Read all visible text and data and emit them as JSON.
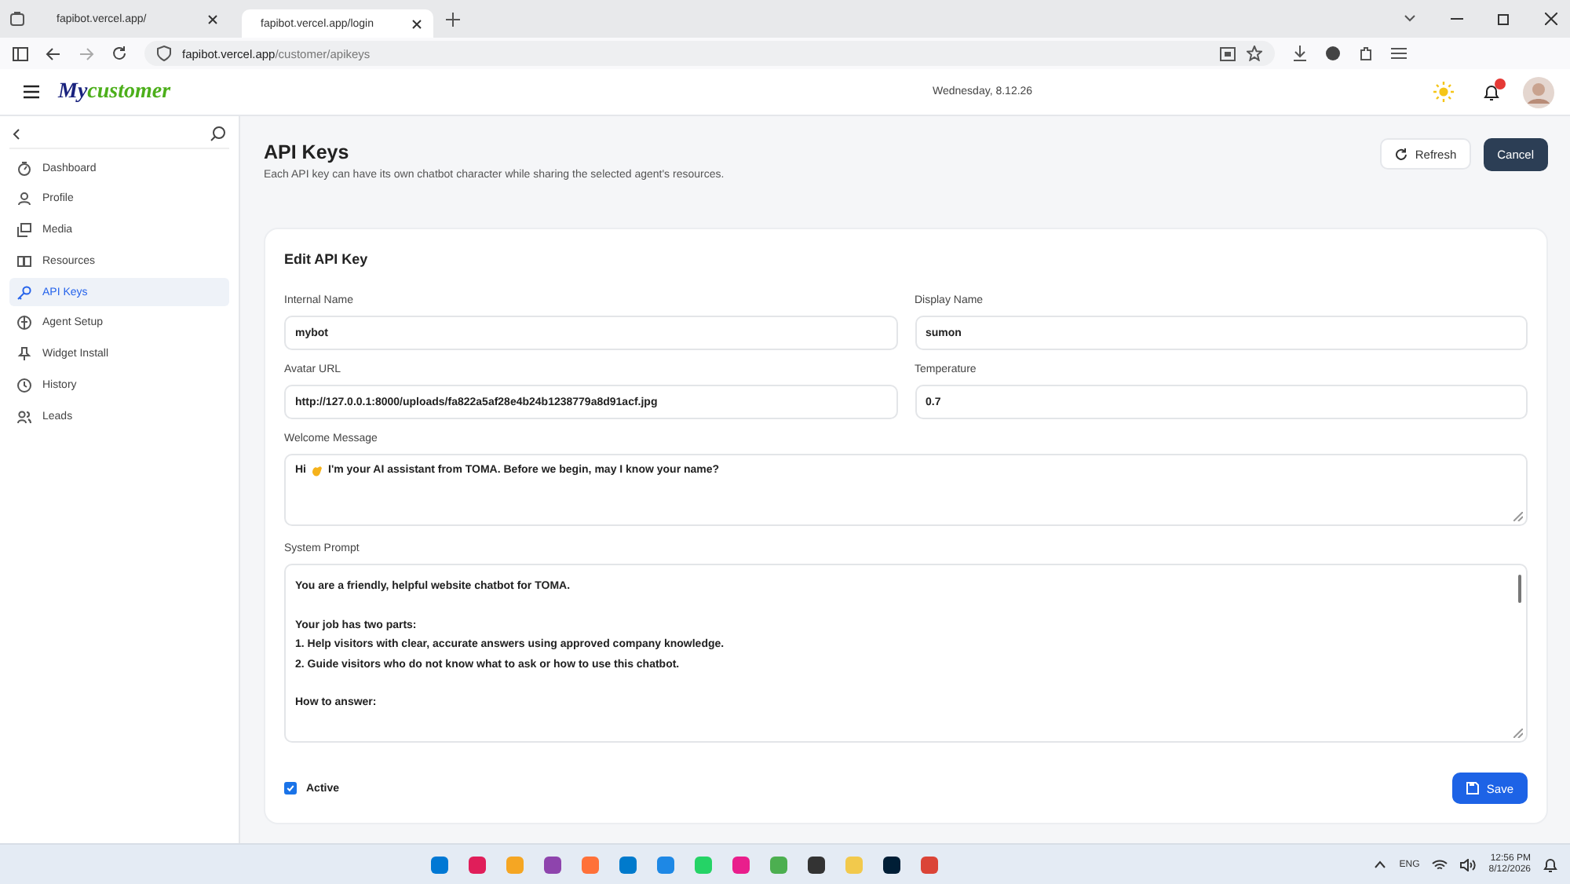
{
  "browser": {
    "tabs": [
      {
        "label": "fapibot.vercel.app/",
        "selected": false
      },
      {
        "label": "fapibot.vercel.app/login",
        "selected": true
      }
    ],
    "address": {
      "host": "fapibot.vercel.app",
      "path": "/customer/apikeys"
    }
  },
  "header": {
    "logo_first": "My",
    "logo_second": "customer",
    "date": "Wednesday, 8.12.26"
  },
  "sidebar": {
    "items": [
      {
        "label": "Dashboard",
        "selected": false
      },
      {
        "label": "Profile",
        "selected": false
      },
      {
        "label": "Media",
        "selected": false
      },
      {
        "label": "Resources",
        "selected": false
      },
      {
        "label": "API Keys",
        "selected": true
      },
      {
        "label": "Agent Setup",
        "selected": false
      },
      {
        "label": "Widget Install",
        "selected": false
      },
      {
        "label": "History",
        "selected": false
      },
      {
        "label": "Leads",
        "selected": false
      }
    ]
  },
  "page": {
    "title": "API Keys",
    "subtitle": "Each API key can have its own chatbot character while sharing the selected agent's resources.",
    "refresh": "Refresh",
    "cancel": "Cancel"
  },
  "form": {
    "title": "Edit API Key",
    "fields": [
      {
        "label": "Internal Name",
        "value": "mybot"
      },
      {
        "label": "Display Name",
        "value": "sumon"
      },
      {
        "label": "Avatar URL",
        "value": "http://127.0.0.1:8000/uploads/fa822a5af28e4b24b1238779a8d91acf.jpg"
      },
      {
        "label": "Temperature",
        "value": "0.7"
      }
    ],
    "welcome": {
      "label": "Welcome Message",
      "before": "Hi",
      "after": "I'm your AI assistant from TOMA. Before we begin, may I know your name?"
    },
    "prompt": {
      "label": "System Prompt",
      "paragraphs": [
        [
          "You are a friendly, helpful website chatbot for TOMA."
        ],
        [
          "Your job has two parts:",
          "1. Help visitors with clear, accurate answers using approved company knowledge.",
          "2. Guide visitors who do not know what to ask or how to use this chatbot."
        ],
        [
          "How to answer:"
        ]
      ]
    },
    "active": {
      "label": "Active",
      "checked": true
    },
    "save": "Save"
  },
  "taskbar": {
    "lang": "ENG",
    "time": "12:56 PM",
    "date": "8/12/2026"
  }
}
